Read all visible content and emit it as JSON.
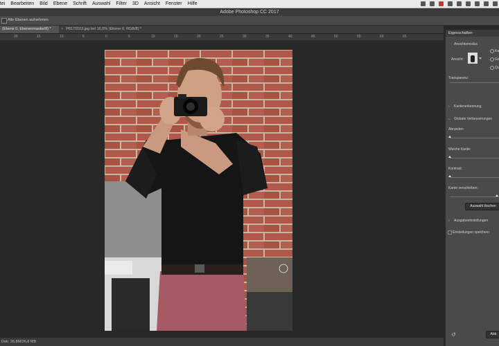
{
  "menubar": {
    "items": [
      "atei",
      "Bearbeiten",
      "Bild",
      "Ebene",
      "Schrift",
      "Auswahl",
      "Filter",
      "3D",
      "Ansicht",
      "Fenster",
      "Hilfe"
    ]
  },
  "window": {
    "title": "Adobe Photoshop CC 2017"
  },
  "options_bar": {
    "checkbox_label": "Alle Ebenen aufnehmen"
  },
  "tabs": [
    {
      "label": "(Ebene 0, Ebenenmaske/8) *",
      "active": true
    },
    {
      "label": "P8170103.jpg bei 16,5% (Ebene 0, RGB/8) *",
      "active": false
    }
  ],
  "ruler": {
    "marks": [
      "20",
      "15",
      "10",
      "5",
      "0",
      "5",
      "10",
      "15",
      "20",
      "25",
      "30",
      "35",
      "40",
      "45",
      "50",
      "55",
      "60",
      "65"
    ]
  },
  "status": {
    "text": "Dok: 26,8M/26,8 MB"
  },
  "panel": {
    "title": "Eigenschaften",
    "view_mode_label": "Ansichtsmodus",
    "view_label": "Ansicht:",
    "view_options": [
      "Ka",
      "Ge",
      "Qu"
    ],
    "transparency_label": "Transparenz:",
    "edge_detection_label": "Kantenerkennung",
    "global_refinements_label": "Globale Verbesserungen",
    "smooth_label": "Abrunden",
    "feather_label": "Weiche Kante:",
    "contrast_label": "Kontrast:",
    "shift_edge_label": "Kante verschieben:",
    "clear_selection_button": "Auswahl löschen",
    "output_settings_label": "Ausgabeeinstellungen",
    "remember_settings_label": "Einstellungen speichern",
    "ok_label": "Abb"
  },
  "colors": {
    "menubar_bg": "#e9e9e9",
    "workspace_bg": "#282828",
    "panel_bg": "#4a4a4a",
    "brick": "#a55a48",
    "shirt": "#151515",
    "jeans": "#a65a63"
  }
}
